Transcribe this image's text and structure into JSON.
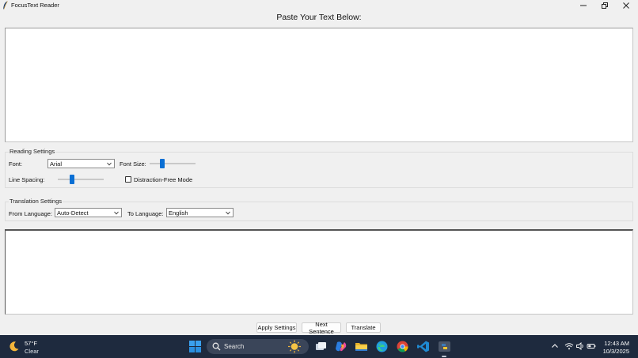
{
  "window": {
    "title": "FocusText Reader",
    "icon": "feather-icon",
    "controls": {
      "minimize": "minimize-icon",
      "maximize": "restore-icon",
      "close": "close-icon"
    }
  },
  "main": {
    "heading": "Paste Your Text Below:",
    "input_text": "",
    "output_text": ""
  },
  "reading_settings": {
    "title": "Reading Settings",
    "font_label": "Font:",
    "font_value": "Arial",
    "font_size_label": "Font Size:",
    "font_size_level": 0.25,
    "line_spacing_label": "Line Spacing:",
    "line_spacing_level": 0.28,
    "distraction_free_label": "Distraction-Free Mode",
    "distraction_free_checked": false
  },
  "translation_settings": {
    "title": "Translation Settings",
    "from_label": "From Language:",
    "from_value": "Auto-Detect",
    "to_label": "To Language:",
    "to_value": "English"
  },
  "buttons": {
    "apply": "Apply Settings",
    "next": "Next Sentence",
    "translate": "Translate"
  },
  "taskbar": {
    "weather_temp": "57°F",
    "weather_condition": "Clear",
    "search_label": "Search",
    "apps": [
      "windows-start-icon",
      "task-view-icon",
      "copilot-icon",
      "file-explorer-icon",
      "edge-icon",
      "chrome-icon",
      "vscode-icon",
      "python-icon"
    ],
    "tray": [
      "chevron-up-icon",
      "wifi-icon",
      "volume-icon",
      "battery-icon"
    ],
    "time": "12:43 AM",
    "date": "10/3/2025"
  },
  "colors": {
    "accent": "#0a6fd4",
    "taskbar_bg": "#1e2a3e",
    "window_bg": "#f0f0f0"
  }
}
